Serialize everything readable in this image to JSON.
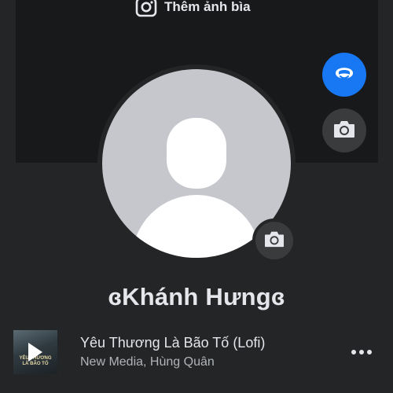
{
  "cover": {
    "add_cover_label": "Thêm ảnh bìa",
    "icon": "camera-icon"
  },
  "profile": {
    "name": "ɞKhánh Hưngɞ",
    "avatar_icon": "default-avatar-silhouette",
    "avatar_camera_icon": "camera-icon"
  },
  "side_buttons": {
    "avatar_creator_icon": "avatar-face-icon",
    "camera_icon": "camera-icon"
  },
  "music": {
    "cover_caption": "YÊU THƯƠNG LÀ BÃO TỐ",
    "title": "Yêu Thương Là Bão Tố (Lofi)",
    "artist": "New Media, Hùng Quân",
    "more_icon": "more-horizontal-icon"
  },
  "colors": {
    "background": "#242526",
    "cover": "#18191a",
    "accent_blue": "#1877f2",
    "button_gray": "#3a3b3c",
    "text_primary": "#e4e6eb",
    "text_secondary": "#b0b3b8"
  }
}
